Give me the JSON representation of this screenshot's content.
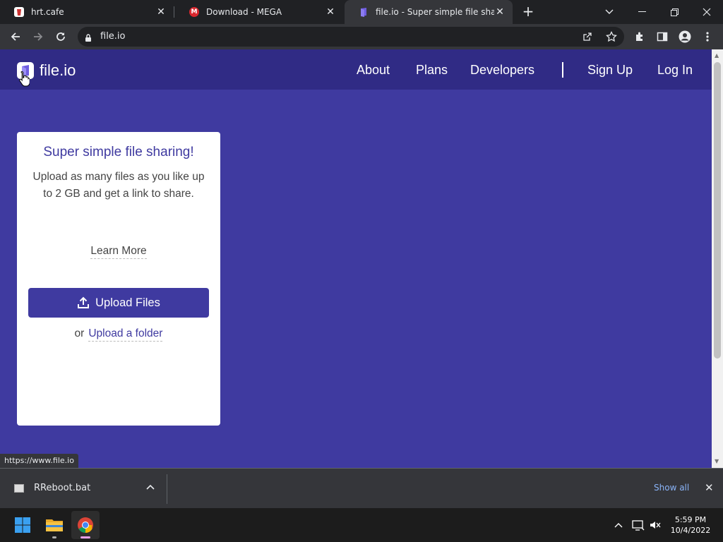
{
  "browser": {
    "tabs": [
      {
        "title": "hrt.cafe",
        "favicon_color": "#ffffff",
        "active": false
      },
      {
        "title": "Download - MEGA",
        "favicon_color": "#d9272e",
        "favicon_text": "M",
        "active": false
      },
      {
        "title": "file.io - Super simple file sharing",
        "favicon_color": "#6f5de0",
        "active": true
      }
    ],
    "address": "file.io",
    "status_url": "https://www.file.io"
  },
  "site": {
    "logo_text": "file.io",
    "nav": {
      "about": "About",
      "plans": "Plans",
      "developers": "Developers",
      "signup": "Sign Up",
      "login": "Log In"
    },
    "card": {
      "title": "Super simple file sharing!",
      "description": "Upload as many files as you like up to 2 GB and get a link to share.",
      "learn_more": "Learn More",
      "upload_button": "Upload Files",
      "or_text": "or",
      "upload_folder": "Upload a folder"
    },
    "colors": {
      "brand": "#3f3aa0",
      "nav_bg": "#302b85"
    }
  },
  "downloads": {
    "file_name": "RReboot.bat",
    "show_all": "Show all"
  },
  "taskbar": {
    "time": "5:59 PM",
    "date": "10/4/2022"
  }
}
